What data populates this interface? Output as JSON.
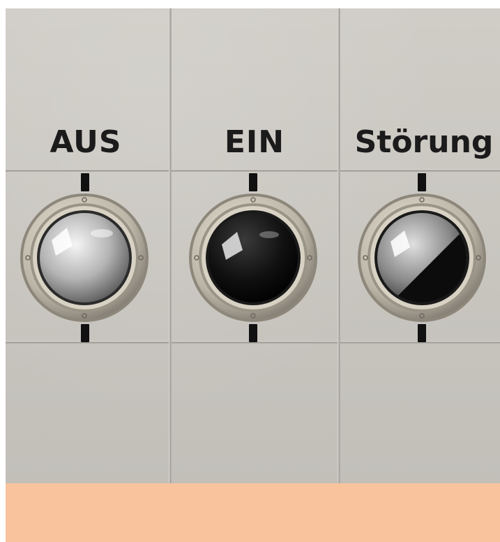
{
  "panel": {
    "lamps": [
      {
        "label": "AUS",
        "state": "off",
        "lens_color": "#bfbfbf"
      },
      {
        "label": "EIN",
        "state": "dark",
        "lens_color": "#101010"
      },
      {
        "label": "Störung",
        "state": "half",
        "lens_color": "#4a4a4a"
      }
    ]
  },
  "colors": {
    "panel": "#cbc8c3",
    "label_text": "#1b1b1b",
    "footer_band": "#f9c39d"
  }
}
